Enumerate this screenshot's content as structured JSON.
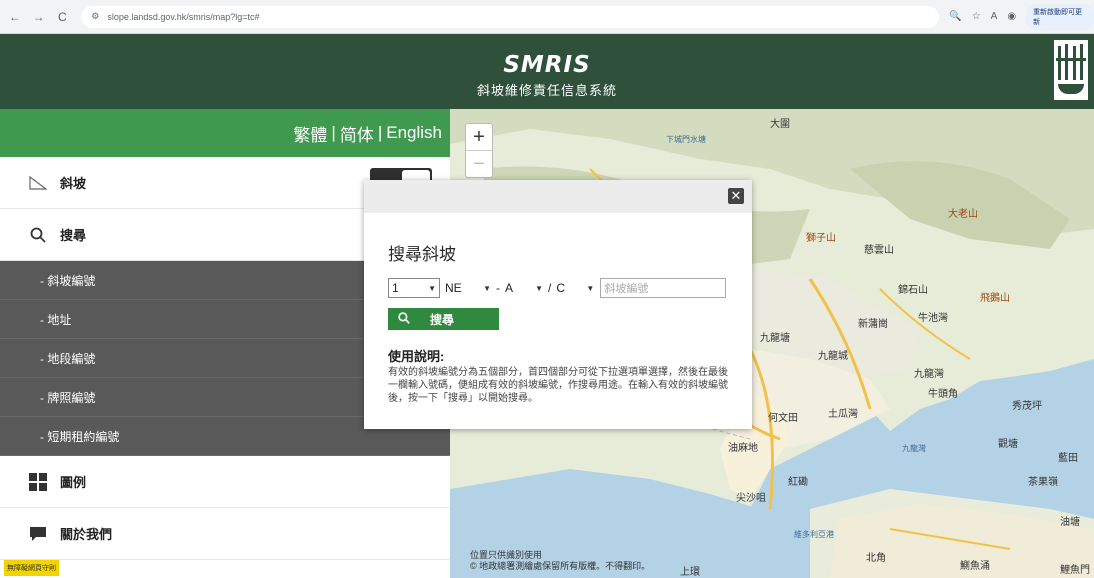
{
  "browser": {
    "url": "slope.landsd.gov.hk/smris/map?lg=tc#",
    "profile_label": "重新啟動即可更新"
  },
  "header": {
    "logo": "SMRIS",
    "subtitle": "斜坡維修責任信息系統"
  },
  "sidebar": {
    "languages": [
      "繁體",
      "简体",
      "English"
    ],
    "language_separator": "|",
    "menu": {
      "slope": "斜坡",
      "search": "搜尋",
      "legend": "圖例",
      "about": "關於我們"
    },
    "search_items": [
      "- 斜坡編號",
      "- 地址",
      "- 地段編號",
      "- 牌照編號",
      "- 短期租約編號"
    ],
    "footer_tag": "無障礙網頁守則"
  },
  "map": {
    "zoom_in": "+",
    "zoom_out": "−",
    "labels": {
      "dawei": "大圍",
      "xiachengmen": "下城門水塘",
      "dalaoshan": "大老山",
      "shiziShan": "獅子山",
      "cixunshan": "慈雲山",
      "jinshan": "錦石山",
      "feiejian": "飛鵝山",
      "jiulongtang": "九龍塘",
      "xinpugang": "新蒲崗",
      "niuchihu": "牛池灣",
      "jiulongcheng": "九龍城",
      "jiulongwan": "九龍灣",
      "niutoujiao": "牛頭角",
      "xiuomaoping": "秀茂坪",
      "hewentian": "何文田",
      "tuguawan": "土瓜灣",
      "jiulongwan_sea": "九龍灣",
      "guantang": "觀塘",
      "lantian": "藍田",
      "chaguoling": "茶果嶺",
      "youjingdi": "油麻地",
      "hongkan": "紅磡",
      "jianshazui": "尖沙咀",
      "weiduoliya": "維多利亞港",
      "beijiao": "北角",
      "zhayuchong": "鰂魚涌",
      "youtang": "油塘",
      "shanghuan": "上環",
      "jiangyumen": "鯉魚門"
    },
    "attribution_line1": "位置只供識別使用",
    "attribution_line2": "© 地政總署測繪處保留所有版權。不得翻印。"
  },
  "modal": {
    "close_label": "✕",
    "title": "搜尋斜坡",
    "selects": {
      "sheet": "1",
      "quadrant": "NE",
      "grid_letter": "A",
      "slope_type": "C"
    },
    "separator_dash": "-",
    "separator_slash": "/",
    "slope_no_placeholder": "斜坡編號",
    "search_button": "搜尋",
    "usage_title": "使用說明:",
    "usage_text": "有效的斜坡編號分為五個部分，首四個部分可從下拉選項單選擇，然後在最後一欄輸入號碼，便組成有效的斜坡編號，作搜尋用途。在輸入有效的斜坡編號後，按一下「搜尋」以開始搜尋。"
  },
  "colors": {
    "header": "#2f503a",
    "lang_bar": "#3f9a4f",
    "submenu": "#595959",
    "search_button": "#2f8a3f"
  }
}
